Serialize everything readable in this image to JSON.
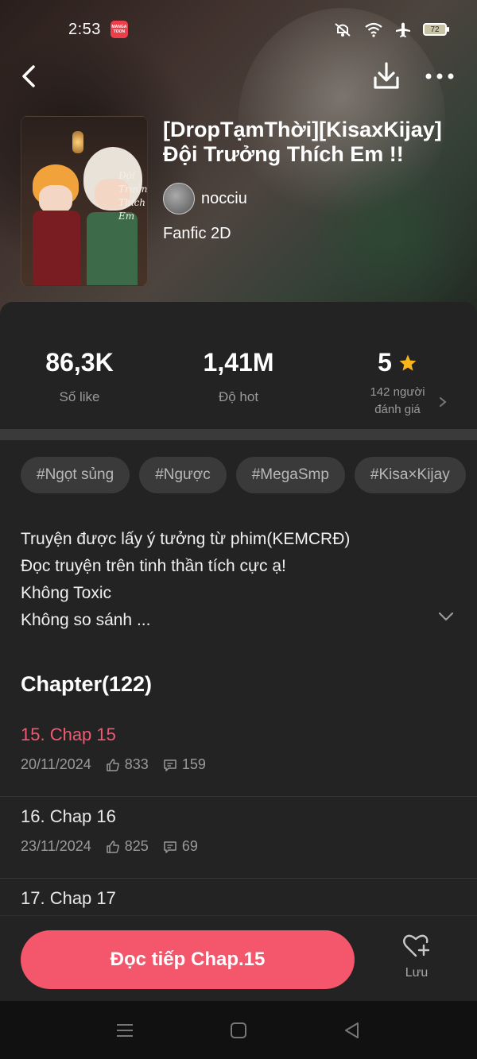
{
  "status_bar": {
    "time": "2:53",
    "app_badge": "MANGA TOON",
    "battery": "72"
  },
  "comic": {
    "title": "[DropTạmThời][KisaxKijay] Đội Trưởng Thích Em !!",
    "cover_text": "Đội Trưởng Thích Em",
    "author": "nocciu",
    "genre": "Fanfic 2D"
  },
  "stats": {
    "likes_value": "86,3K",
    "likes_label": "Số like",
    "hot_value": "1,41M",
    "hot_label": "Độ hot",
    "rating_value": "5",
    "rating_label_1": "142 người",
    "rating_label_2": "đánh giá"
  },
  "tags": [
    "#Ngọt sủng",
    "#Ngược",
    "#MegaSmp",
    "#Kisa×Kijay"
  ],
  "description": [
    "Truyện được lấy ý tưởng từ phim(KEMCRĐ)",
    "Đọc truyện trên tinh thần tích cực ạ!",
    "Không Toxic",
    "Không so sánh ..."
  ],
  "chapters": {
    "heading": "Chapter(122)",
    "items": [
      {
        "name": "15. Chap 15",
        "date": "20/11/2024",
        "likes": "833",
        "comments": "159"
      },
      {
        "name": "16. Chap 16",
        "date": "23/11/2024",
        "likes": "825",
        "comments": "69"
      },
      {
        "name": "17. Chap 17",
        "date": "",
        "likes": "",
        "comments": ""
      }
    ]
  },
  "bottom": {
    "read_label": "Đọc tiếp Chap.15",
    "save_label": "Lưu"
  },
  "colors": {
    "accent": "#f4566c",
    "current_chapter": "#f05a72",
    "star": "#f8b51c",
    "sheet": "#232323"
  }
}
